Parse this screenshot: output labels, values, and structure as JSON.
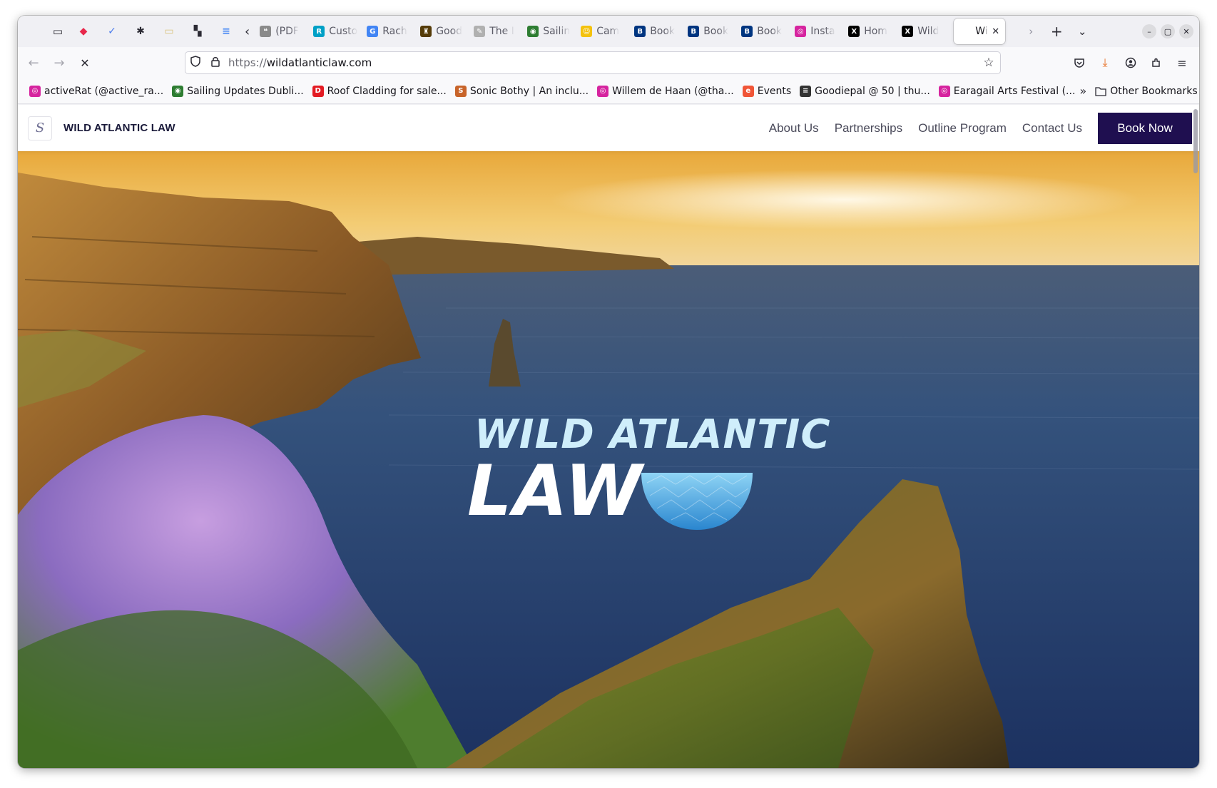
{
  "browser": {
    "tabs": [
      {
        "label": "",
        "favicon": "pocket-icon",
        "color": "#e8274b",
        "pinned": true
      },
      {
        "label": "",
        "favicon": "check-icon",
        "color": "#4b7bec",
        "pinned": true
      },
      {
        "label": "",
        "favicon": "asterisk-icon",
        "color": "#2b2a33",
        "pinned": true
      },
      {
        "label": "",
        "favicon": "tag-icon",
        "color": "#d9c27a",
        "pinned": true
      },
      {
        "label": "",
        "favicon": "code-icon",
        "color": "#2b2a33",
        "pinned": true
      },
      {
        "label": "",
        "favicon": "doc-icon",
        "color": "#4285f4",
        "pinned": true
      },
      {
        "label": "(PDF",
        "favicon": "pdf-icon",
        "color": "#8a8a8a"
      },
      {
        "label": "Custo",
        "favicon": "rte-icon",
        "color": "#00a0c6"
      },
      {
        "label": "Rach",
        "favicon": "google-icon",
        "color": "#4285f4"
      },
      {
        "label": "Good",
        "favicon": "goodreads-icon",
        "color": "#553b08"
      },
      {
        "label": "The I",
        "favicon": "feather-icon",
        "color": "#b0b0b0"
      },
      {
        "label": "Sailin",
        "favicon": "globe-icon",
        "color": "#2e7d32"
      },
      {
        "label": "Cam",
        "favicon": "smile-icon",
        "color": "#f4c20d"
      },
      {
        "label": "Book",
        "favicon": "booking-icon",
        "color": "#003580"
      },
      {
        "label": "Book",
        "favicon": "booking-icon",
        "color": "#003580"
      },
      {
        "label": "Book",
        "favicon": "booking-icon",
        "color": "#003580"
      },
      {
        "label": "Insta",
        "favicon": "instagram-icon",
        "color": "#d6249f"
      },
      {
        "label": "Hom",
        "favicon": "x-icon",
        "color": "#000000"
      },
      {
        "label": "Wild",
        "favicon": "x-icon",
        "color": "#000000"
      }
    ],
    "active_tab": {
      "label": "Wi",
      "close": "✕"
    },
    "url_protocol": "https://",
    "url_host": "wildatlanticlaw.com",
    "bookmarks": [
      {
        "label": "activeRat (@active_ra...",
        "favicon": "instagram-icon",
        "color": "#d6249f"
      },
      {
        "label": "Sailing Updates Dubli...",
        "favicon": "globe-icon",
        "color": "#2e7d32"
      },
      {
        "label": "Roof Cladding for sale...",
        "favicon": "donedeal-icon",
        "color": "#e31b23"
      },
      {
        "label": "Sonic Bothy | An inclu...",
        "favicon": "sonic-icon",
        "color": "#c8642a"
      },
      {
        "label": "Willem de Haan (@tha...",
        "favicon": "instagram-icon",
        "color": "#d6249f"
      },
      {
        "label": "Events",
        "favicon": "eventbrite-icon",
        "color": "#f05537"
      },
      {
        "label": "Goodiepal @ 50 | thu...",
        "favicon": "thu-icon",
        "color": "#333333"
      },
      {
        "label": "Earagail Arts Festival (...",
        "favicon": "instagram-icon",
        "color": "#d6249f"
      }
    ],
    "other_bookmarks": "Other Bookmarks"
  },
  "site": {
    "logo_letter": "S",
    "name": "WILD ATLANTIC LAW",
    "nav": [
      "About Us",
      "Partnerships",
      "Outline Program",
      "Contact Us"
    ],
    "cta": "Book Now",
    "hero_logo_line1": "WILD ATLANTIC",
    "hero_logo_line2": "LAW"
  },
  "colors": {
    "cta_bg": "#1f0f50",
    "logo_light": "#cfeefb",
    "logo_bowl": "#3a9ad9"
  }
}
